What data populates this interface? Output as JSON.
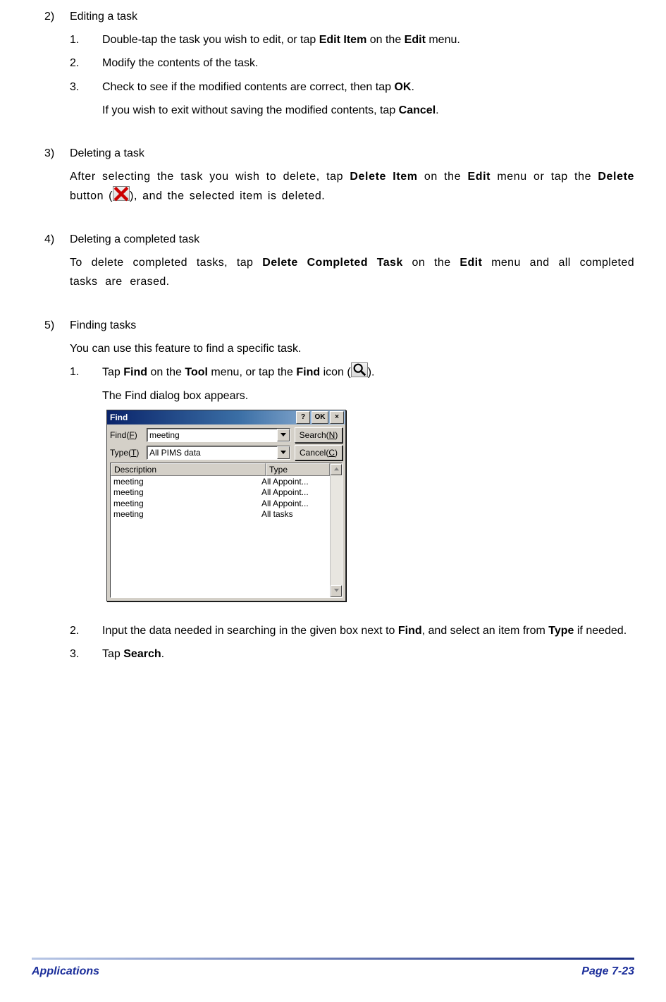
{
  "sections": {
    "s2": {
      "num": "2)",
      "title": "Editing a task",
      "steps": [
        {
          "n": "1.",
          "a": "Double-tap the task you wish to edit, or tap ",
          "b1": "Edit Item",
          "c": " on the ",
          "b2": "Edit",
          "d": " menu."
        },
        {
          "n": "2.",
          "a": "Modify the contents of the task."
        },
        {
          "n": "3.",
          "a": "Check to see if the modified contents are correct, then tap ",
          "b1": "OK",
          "c": ".",
          "cont": {
            "a": "If you wish to exit without saving the modified contents, tap ",
            "b1": "Cancel",
            "c": "."
          }
        }
      ]
    },
    "s3": {
      "num": "3)",
      "title": "Deleting a task",
      "para": {
        "a": "After selecting the task you wish to delete, tap ",
        "b1": "Delete Item",
        "c": " on the ",
        "b2": "Edit",
        "d": " menu or tap the ",
        "b3": "Delete",
        "e": " button (",
        "f": "), and the selected item is deleted."
      }
    },
    "s4": {
      "num": "4)",
      "title": "Deleting a completed task",
      "para": {
        "a": "To delete completed tasks, tap ",
        "b1": "Delete Completed Task",
        "c": " on the ",
        "b2": "Edit",
        "d": " menu and all completed tasks are erased."
      }
    },
    "s5": {
      "num": "5)",
      "title": "Finding tasks",
      "intro": "You can use this feature to find a specific task.",
      "step1": {
        "n": "1.",
        "a": "Tap ",
        "b1": "Find",
        "c": " on the ",
        "b2": "Tool",
        "d": " menu, or tap the ",
        "b3": "Find",
        "e": " icon (",
        "f": ").",
        "cont": "The Find dialog box appears."
      },
      "step2": {
        "n": "2.",
        "a": "Input the data needed in searching in the given box next to ",
        "b1": "Find",
        "c": ", and select an item from ",
        "b2": "Type",
        "d": " if needed."
      },
      "step3": {
        "n": "3.",
        "a": "Tap ",
        "b1": "Search",
        "c": "."
      }
    }
  },
  "dialog": {
    "title": "Find",
    "titlebar_buttons": {
      "help": "?",
      "ok": "OK",
      "close": "×"
    },
    "find_label_pre": "Find(",
    "find_key": "F",
    "find_label_post": ")",
    "type_label_pre": "Type(",
    "type_key": "T",
    "type_label_post": ")",
    "find_value": "meeting",
    "type_value": "All PIMS data",
    "search_btn_pre": "Search(",
    "search_btn_key": "N",
    "search_btn_post": ")",
    "cancel_btn_pre": "Cancel(",
    "cancel_btn_key": "C",
    "cancel_btn_post": ")",
    "headers": {
      "desc": "Description",
      "type": "Type"
    },
    "rows": [
      {
        "desc": "meeting",
        "type": "All Appoint..."
      },
      {
        "desc": "meeting",
        "type": "All Appoint..."
      },
      {
        "desc": "meeting",
        "type": "All Appoint..."
      },
      {
        "desc": "meeting",
        "type": "All tasks"
      }
    ]
  },
  "footer": {
    "left": "Applications",
    "right": "Page 7-23"
  }
}
